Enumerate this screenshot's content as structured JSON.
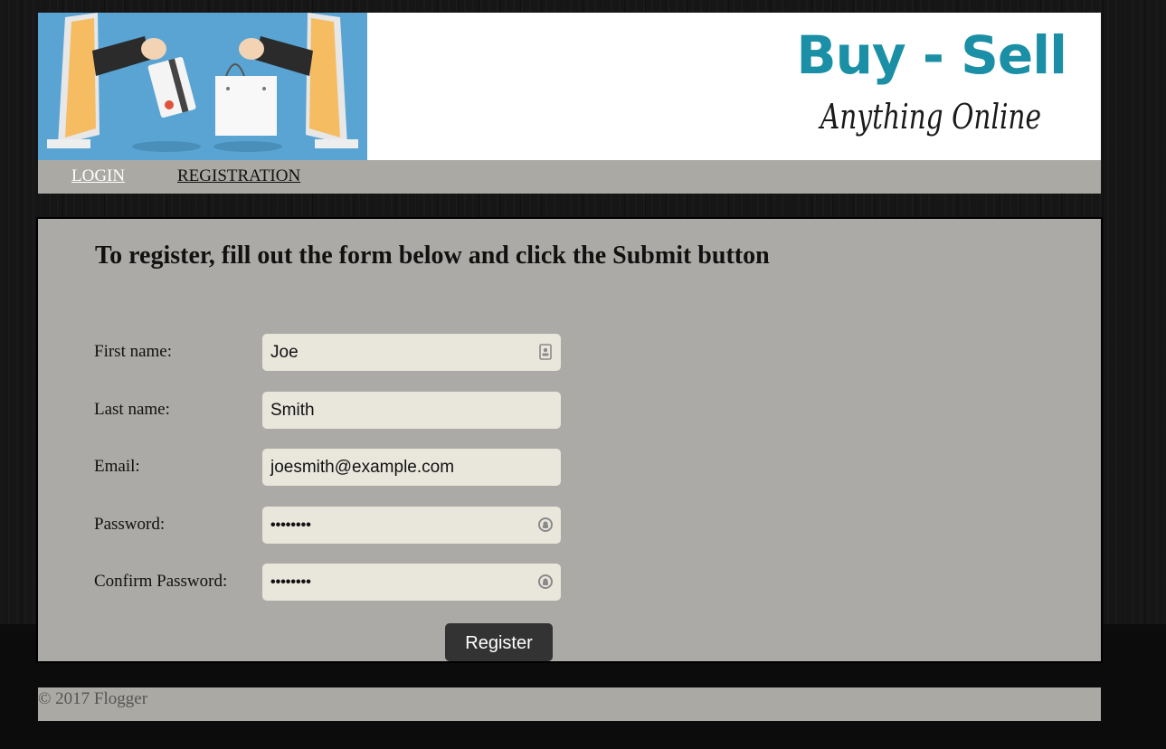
{
  "header": {
    "logo_title": "Buy - Sell",
    "logo_subtitle": "Anything Online",
    "banner_image": "online-shopping-illustration"
  },
  "nav": {
    "login": "LOGIN",
    "registration": "REGISTRATION"
  },
  "main": {
    "heading": "To register, fill out the form below and click the Submit button",
    "fields": [
      {
        "label": "First name:",
        "value": "Joe",
        "icon": "contact-card-icon"
      },
      {
        "label": "Last name:",
        "value": "Smith"
      },
      {
        "label": "Email:",
        "value": "joesmith@example.com"
      },
      {
        "label": "Password:",
        "value": "••••••••",
        "icon": "password-key-icon"
      },
      {
        "label": "Confirm Password:",
        "value": "••••••••",
        "icon": "password-key-icon"
      }
    ],
    "submit_label": "Register"
  },
  "footer": {
    "text": "© 2017 Flogger"
  },
  "colors": {
    "page_bg": "#161616",
    "panel_bg": "#acaaa6",
    "input_bg": "#e9e6dc",
    "button_bg": "#333333",
    "logo_accent": "#1a8fa6"
  }
}
